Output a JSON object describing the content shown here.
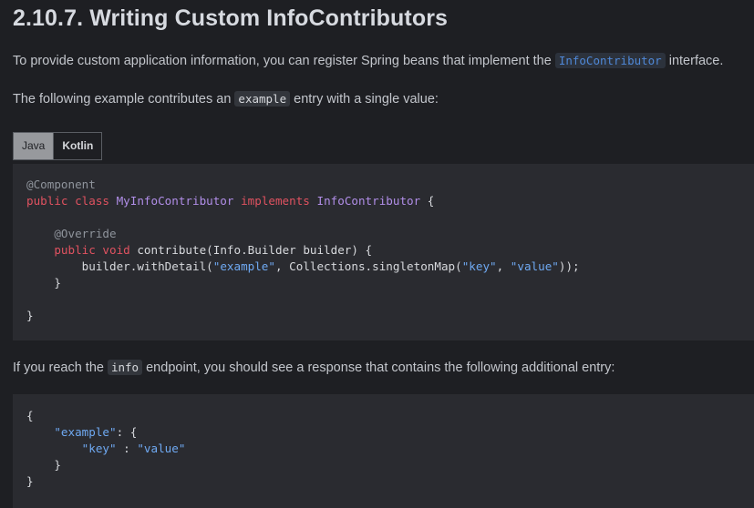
{
  "heading": "2.10.7. Writing Custom InfoContributors",
  "para1": {
    "before": "To provide custom application information, you can register Spring beans that implement the ",
    "code": "InfoContributor",
    "after": " interface."
  },
  "para2": {
    "before": "The following example contributes an ",
    "code": "example",
    "after": " entry with a single value:"
  },
  "tabs": [
    {
      "label": "Java",
      "active": true
    },
    {
      "label": "Kotlin",
      "active": false
    }
  ],
  "java_code": {
    "annotation1": "@Component",
    "kw_public_class": "public class ",
    "class_name": "MyInfoContributor",
    "kw_implements": " implements ",
    "interface_name": "InfoContributor",
    "open_brace": " {",
    "annotation2": "@Override",
    "kw_public_void": "public void ",
    "method_sig": "contribute(Info.Builder builder) {",
    "call_start": "builder.withDetail(",
    "str_example": "\"example\"",
    "call_mid": ", Collections.singletonMap(",
    "str_key": "\"key\"",
    "comma": ", ",
    "str_value": "\"value\"",
    "call_end": "));",
    "inner_close": "}",
    "outer_close": "}"
  },
  "para3": {
    "before": "If you reach the ",
    "code": "info",
    "after": " endpoint, you should see a response that contains the following additional entry:"
  },
  "json_code": {
    "open": "{",
    "key_example": "\"example\"",
    "colon_open": ": {",
    "key_key": "\"key\"",
    "sep": " : ",
    "val_value": "\"value\"",
    "inner_close": "}",
    "outer_close": "}"
  }
}
